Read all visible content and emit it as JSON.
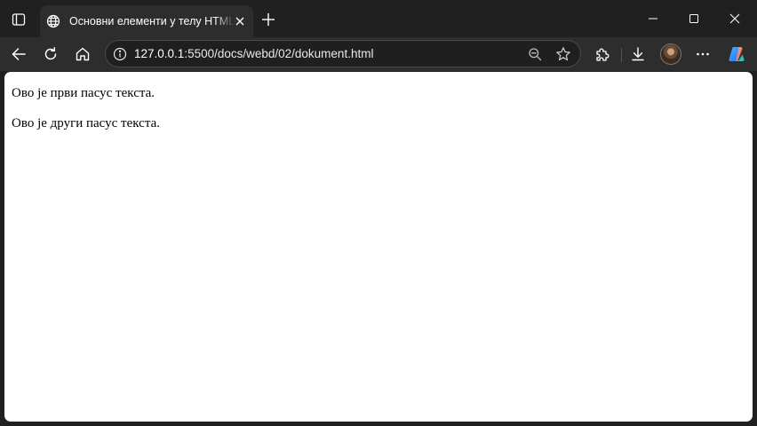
{
  "browser": {
    "tab": {
      "title": "Основни елементи у телу HTML",
      "favicon": "globe-icon",
      "close": "close-icon"
    },
    "new_tab": "plus-icon",
    "window_controls": [
      "minimize-icon",
      "maximize-icon",
      "close-icon"
    ],
    "toolbar": {
      "back": "arrow-left-icon",
      "reload": "reload-icon",
      "home": "home-icon",
      "url_host": "127.0.0.1",
      "url_rest": ":5500/docs/webd/02/dokument.html",
      "site_info": "info-icon",
      "zoom": "zoom-out-icon",
      "favorite": "star-icon",
      "extensions": "puzzle-icon",
      "downloads": "download-icon",
      "profile": "avatar",
      "more": "more-icon",
      "copilot": "copilot-icon"
    }
  },
  "document": {
    "paragraphs": [
      "Ово је први пасус текста.",
      "Ово је други пасус текста."
    ]
  },
  "colors": {
    "titlebar": "#202020",
    "toolbar": "#2d2d2d",
    "page": "#ffffff",
    "text": "#000000"
  }
}
